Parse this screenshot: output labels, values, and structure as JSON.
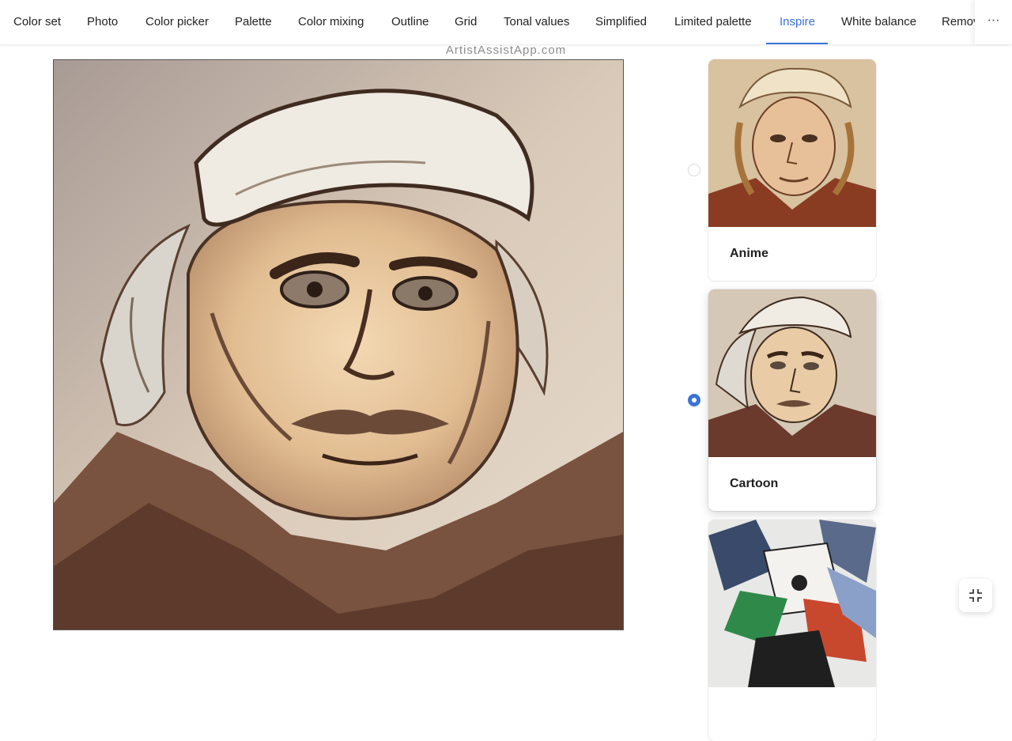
{
  "tabs": [
    {
      "label": "Color set"
    },
    {
      "label": "Photo"
    },
    {
      "label": "Color picker"
    },
    {
      "label": "Palette"
    },
    {
      "label": "Color mixing"
    },
    {
      "label": "Outline"
    },
    {
      "label": "Grid"
    },
    {
      "label": "Tonal values"
    },
    {
      "label": "Simplified"
    },
    {
      "label": "Limited palette"
    },
    {
      "label": "Inspire",
      "active": true
    },
    {
      "label": "White balance"
    },
    {
      "label": "Remov"
    }
  ],
  "more_label": "···",
  "watermark": "ArtistAssistApp.com",
  "styles": [
    {
      "label": "Anime",
      "selected": false
    },
    {
      "label": "Cartoon",
      "selected": true
    },
    {
      "label": "",
      "selected": false
    }
  ],
  "colors": {
    "accent": "#3b73d8",
    "text": "#1f1f1f"
  },
  "icons": {
    "more": "ellipsis-icon",
    "fullscreen_exit": "compress-icon"
  }
}
